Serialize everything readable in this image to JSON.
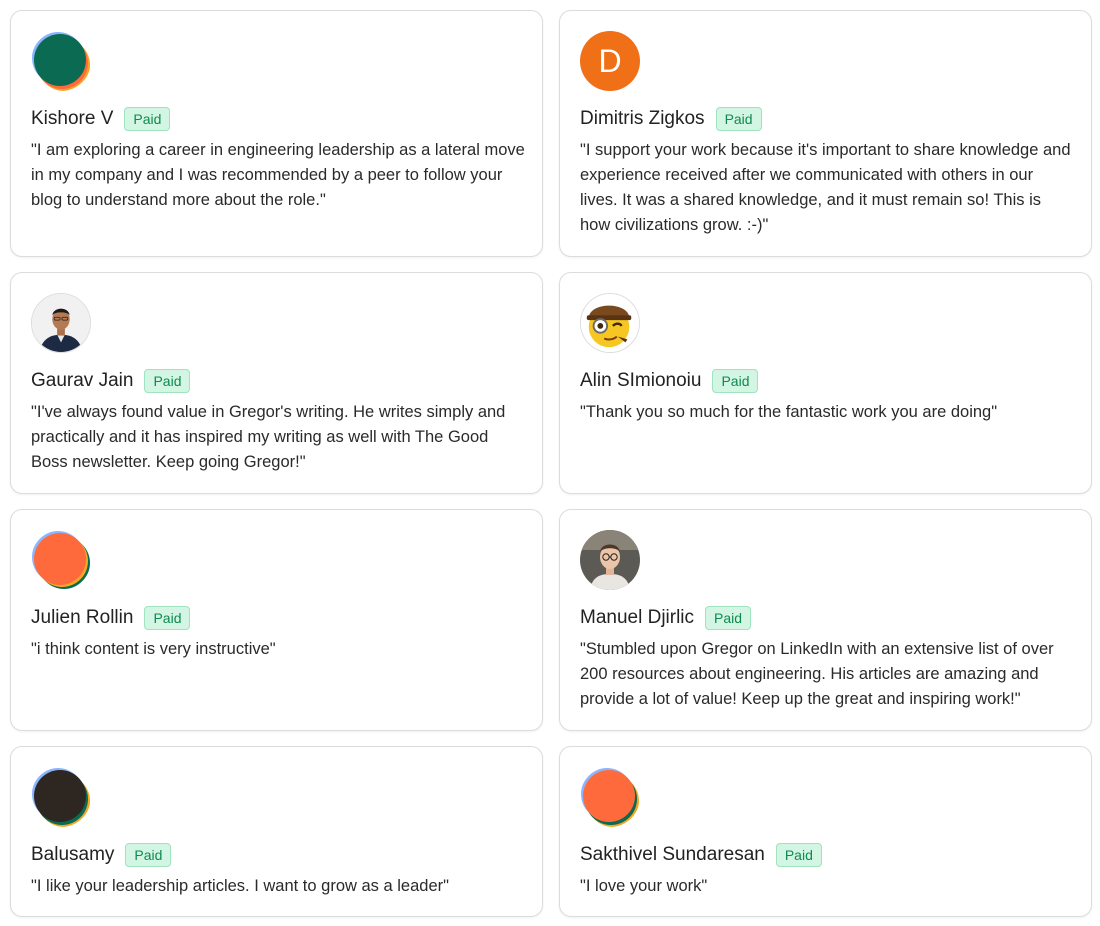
{
  "badge_label": "Paid",
  "cards": [
    {
      "name": "Kishore V",
      "quote": "\"I am exploring a career in engineering leadership as a lateral move in my company and I was recommended by a peer to follow your blog to understand more about the role.\"",
      "avatar_icon": "generic-substack-avatar-icon"
    },
    {
      "name": "Dimitris Zigkos",
      "quote": "\"I support your work because it's important to share knowledge and experience received after we communicated with others in our lives. It was a shared knowledge, and it must remain so! This is how civilizations grow. :-)\"",
      "avatar_letter": "D"
    },
    {
      "name": "Gaurav Jain",
      "quote": "\"I've always found value in Gregor's writing. He writes simply and practically and it has inspired my writing as well with The Good Boss newsletter. Keep going Gregor!\"",
      "avatar_icon": "profile-photo"
    },
    {
      "name": "Alin SImionoiu",
      "quote": "\"Thank you so much for the fantastic work you are doing\"",
      "avatar_icon": "detective-emoji-icon"
    },
    {
      "name": "Julien Rollin",
      "quote": "\"i think content is very instructive\"",
      "avatar_icon": "generic-substack-avatar-icon"
    },
    {
      "name": "Manuel Djirlic",
      "quote": "\"Stumbled upon Gregor on LinkedIn with an extensive list of over 200 resources about engineering. His articles are amazing and provide a lot of value! Keep up the great and inspiring work!\"",
      "avatar_icon": "profile-photo"
    },
    {
      "name": "Balusamy",
      "quote": "\"I like your leadership articles. I want to grow as a leader\"",
      "avatar_icon": "generic-substack-avatar-icon"
    },
    {
      "name": "Sakthivel Sundaresan",
      "quote": "\"I love your work\"",
      "avatar_icon": "generic-substack-avatar-icon"
    }
  ],
  "colors": {
    "badge_bg": "#d3f5e3",
    "badge_text": "#0f8a4f",
    "letter_avatar_bg": "#f07018",
    "avatar_green": "#0a6a52",
    "avatar_orange": "#ff6a3d",
    "avatar_dark": "#2e2620"
  }
}
